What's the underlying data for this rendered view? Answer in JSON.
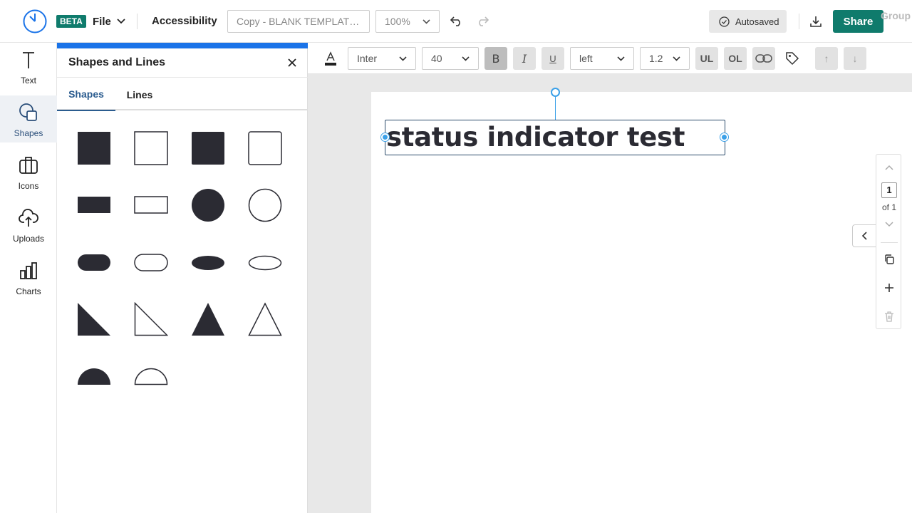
{
  "topbar": {
    "beta_badge": "BETA",
    "file_label": "File",
    "accessibility_label": "Accessibility",
    "title_input_value": "Copy - BLANK TEMPLAT…",
    "zoom_value": "100%",
    "autosaved_label": "Autosaved",
    "share_label": "Share"
  },
  "rail": {
    "items": [
      {
        "label": "Text",
        "icon": "text-icon"
      },
      {
        "label": "Shapes",
        "icon": "shapes-icon"
      },
      {
        "label": "Icons",
        "icon": "icons-icon"
      },
      {
        "label": "Uploads",
        "icon": "upload-icon"
      },
      {
        "label": "Charts",
        "icon": "chart-icon"
      }
    ],
    "active": "Shapes"
  },
  "panel": {
    "title": "Shapes and Lines",
    "tabs": [
      "Shapes",
      "Lines"
    ],
    "active_tab": "Shapes"
  },
  "format_bar": {
    "font_family": "Inter",
    "font_size": "40",
    "bold_label": "B",
    "italic_label": "I",
    "underline_label": "U",
    "align": "left",
    "line_height": "1.2",
    "ul_label": "UL",
    "ol_label": "OL",
    "up_label": "↑",
    "down_label": "↓",
    "group_label": "Group"
  },
  "canvas": {
    "text": "status indicator test"
  },
  "pager": {
    "current": "1",
    "total_label": "of 1"
  },
  "colors": {
    "accent": "#0f7b6c",
    "selection": "#3aa0e8",
    "panel_top": "#1a73e8",
    "shape_fill": "#2b2b33"
  }
}
